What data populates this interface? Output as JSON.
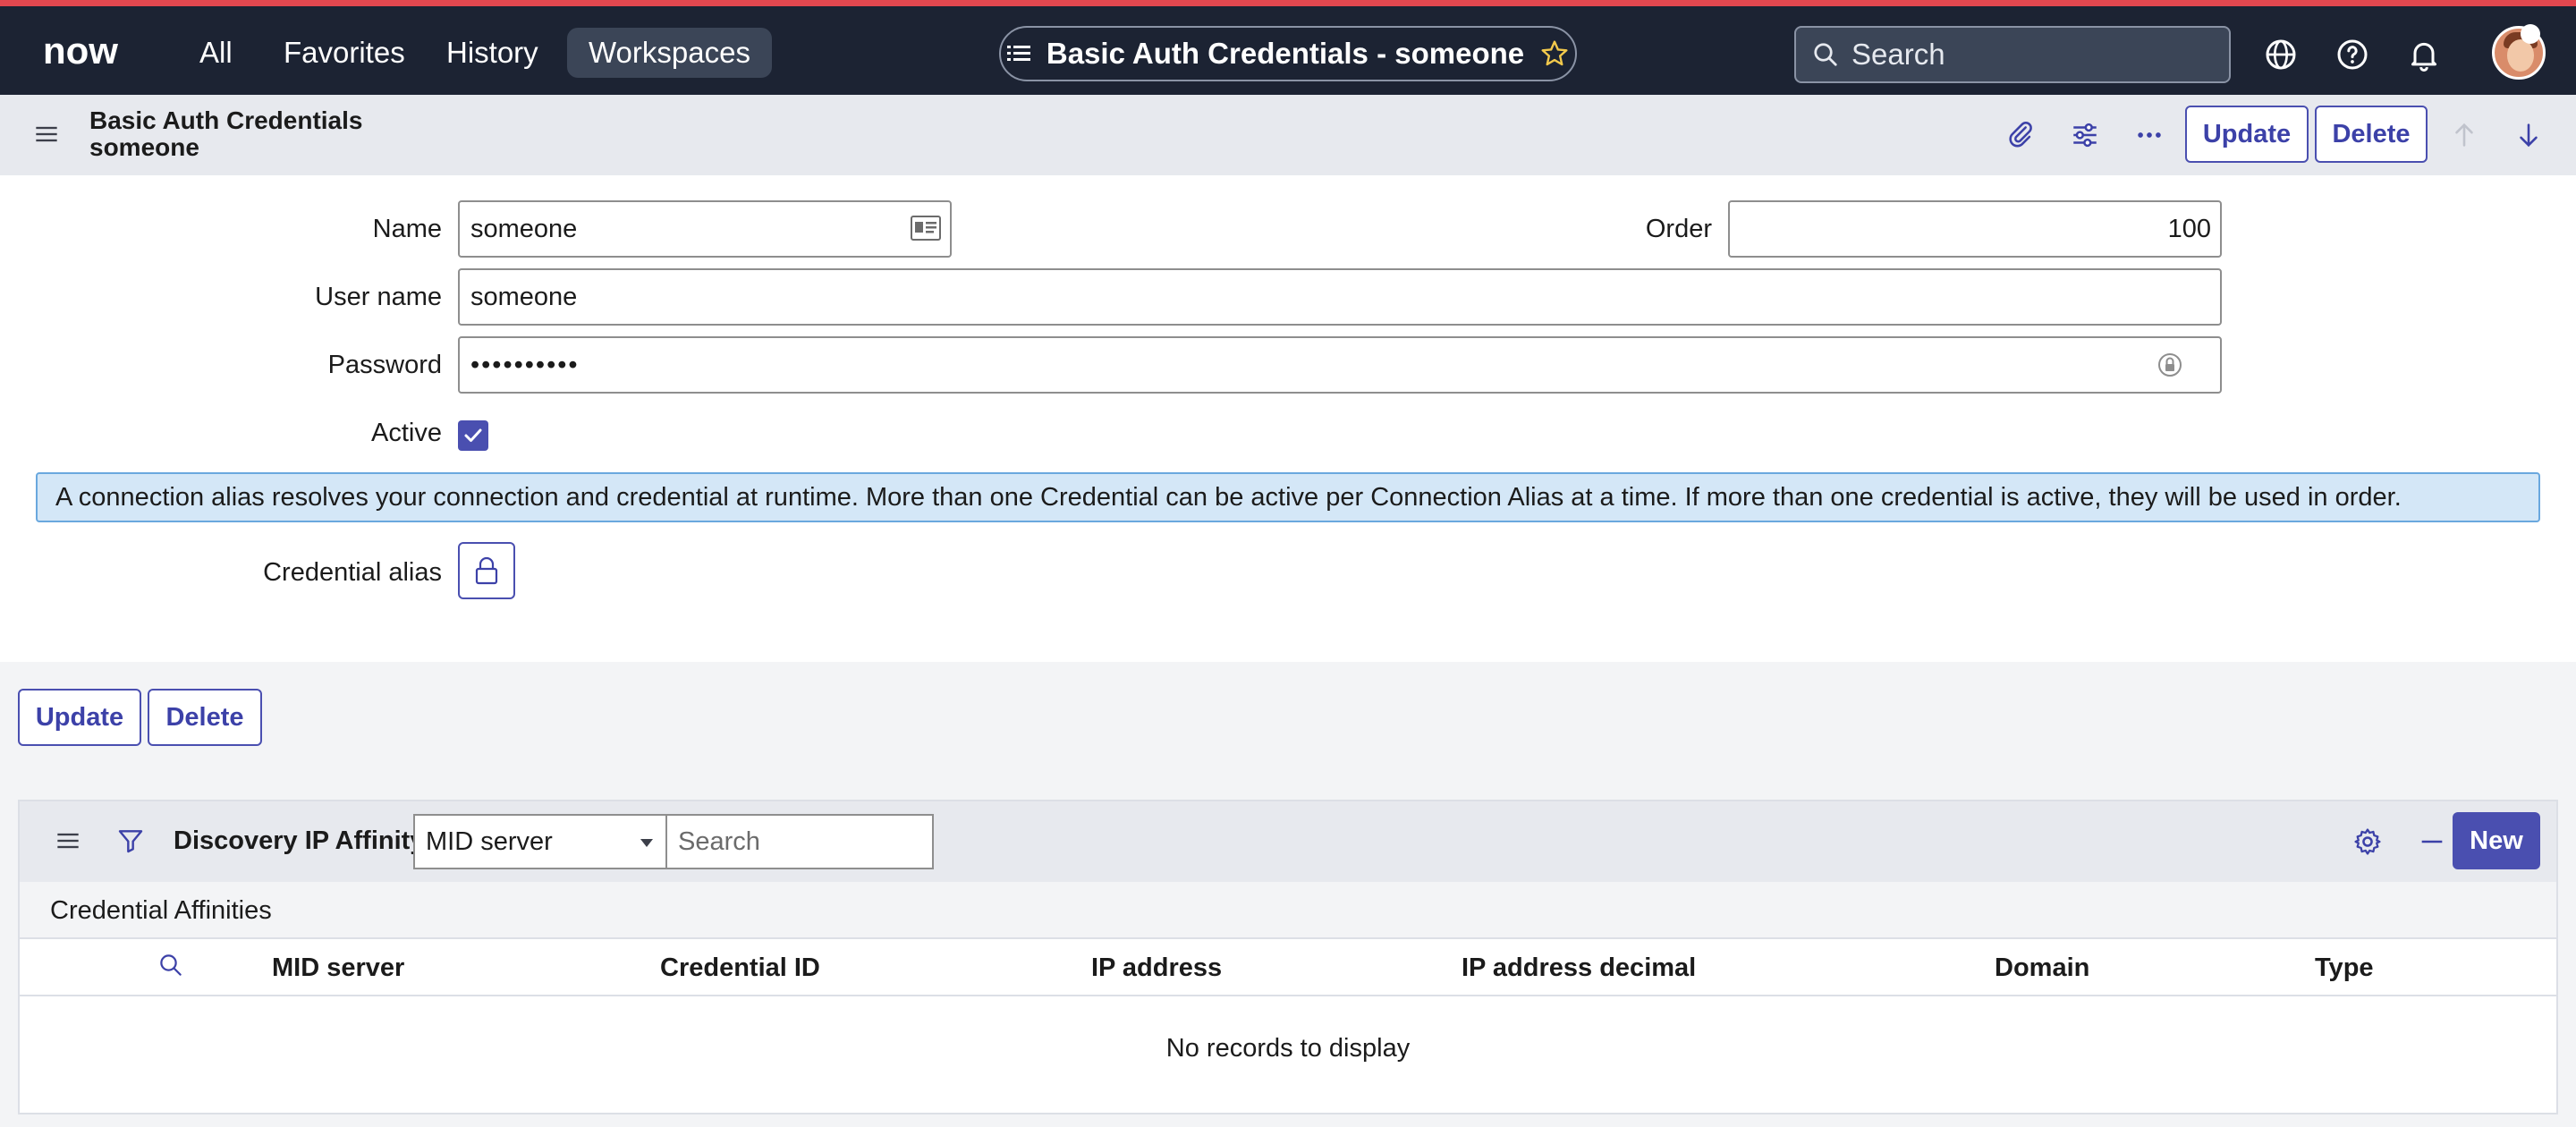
{
  "nav": {
    "logo": "now",
    "links": [
      "All",
      "Favorites",
      "History",
      "Workspaces"
    ],
    "record_title": "Basic Auth Credentials - someone",
    "search_placeholder": "Search",
    "accent_color": "#e2474f"
  },
  "form_header": {
    "title_line1": "Basic Auth Credentials",
    "title_line2": "someone",
    "update_label": "Update",
    "delete_label": "Delete"
  },
  "form": {
    "name_label": "Name",
    "name_value": "someone",
    "order_label": "Order",
    "order_value": "100",
    "username_label": "User name",
    "username_value": "someone",
    "password_label": "Password",
    "password_value": "••••••••••",
    "active_label": "Active",
    "active_checked": true,
    "info_message": "A connection alias resolves your connection and credential at runtime. More than one Credential can be active per Connection Alias at a time. If more than one credential is active, they will be used in order.",
    "credential_alias_label": "Credential alias"
  },
  "bottom_buttons": {
    "update_label": "Update",
    "delete_label": "Delete"
  },
  "related_list": {
    "title": "Discovery IP Affinity",
    "filter_field": "MID server",
    "search_placeholder": "Search",
    "new_label": "New",
    "subtitle": "Credential Affinities",
    "columns": [
      "MID server",
      "Credential ID",
      "IP address",
      "IP address decimal",
      "Domain",
      "Type"
    ],
    "empty_message": "No records to display"
  }
}
